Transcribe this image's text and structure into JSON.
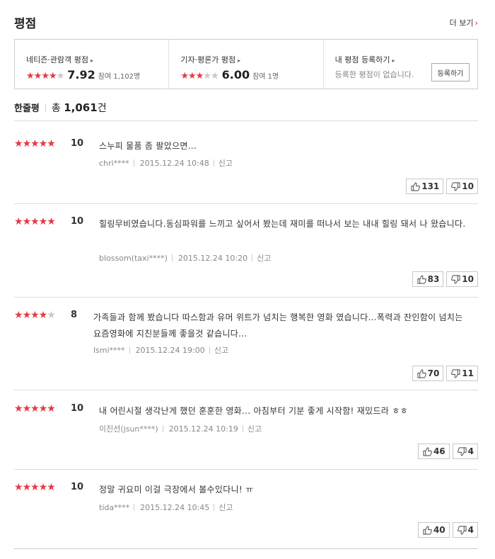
{
  "header": {
    "title": "평점",
    "more_label": "더 보기"
  },
  "summary": {
    "netizen": {
      "title": "네티즌·관람객 평점",
      "stars": 4,
      "score": "7.92",
      "participants": "참여 1,102명"
    },
    "critic": {
      "title": "기자·평론가 평점",
      "stars": 3,
      "score": "6.00",
      "participants": "참여 1명"
    },
    "mine": {
      "title": "내 평점 등록하기",
      "empty_message": "등록한 평점이 없습니다.",
      "register_label": "등록하기"
    }
  },
  "total": {
    "label": "한줄평",
    "prefix": "총",
    "count": "1,061",
    "suffix": "건"
  },
  "reviews": [
    {
      "stars": 5,
      "score": "10",
      "text": "스누피 물품 좀 팔았으면...",
      "user": "chri****",
      "date": "2015.12.24 10:48",
      "report": "신고",
      "likes": "131",
      "dislikes": "10"
    },
    {
      "stars": 5,
      "score": "10",
      "text": "힐링무비였습니다.동심파워를 느끼고 싶어서 봤는데 재미를 떠나서 보는 내내 힐링 돼서 나 왔습니다.",
      "user": "blossom(taxi****)",
      "date": "2015.12.24 10:20",
      "report": "신고",
      "likes": "83",
      "dislikes": "10"
    },
    {
      "stars": 4,
      "score": "8",
      "text": "가족들과 함께 봤습니다 따스함과 유머 위트가 넘치는 행복한 영화 였습니다...폭력과 잔인함이 넘치는 요즘영화에 지친분들께 좋을것 같습니다...",
      "user": "lsmi****",
      "date": "2015.12.24 19:00",
      "report": "신고",
      "likes": "70",
      "dislikes": "11"
    },
    {
      "stars": 5,
      "score": "10",
      "text": "내 어린시절 생각난게 했던 훈훈한 영화... 아침부터 기분 좋게 시작함! 재밌드라 ㅎㅎ",
      "user": "이진선(jsun****)",
      "date": "2015.12.24 10:19",
      "report": "신고",
      "likes": "46",
      "dislikes": "4"
    },
    {
      "stars": 5,
      "score": "10",
      "text": "정말 귀요미 이걸 극장에서 볼수있다니! ㅠ",
      "user": "tida****",
      "date": "2015.12.24 10:45",
      "report": "신고",
      "likes": "40",
      "dislikes": "4"
    }
  ],
  "colors": {
    "star": "#e53845",
    "star_empty": "#c8c8c8",
    "accent": "#e54"
  }
}
